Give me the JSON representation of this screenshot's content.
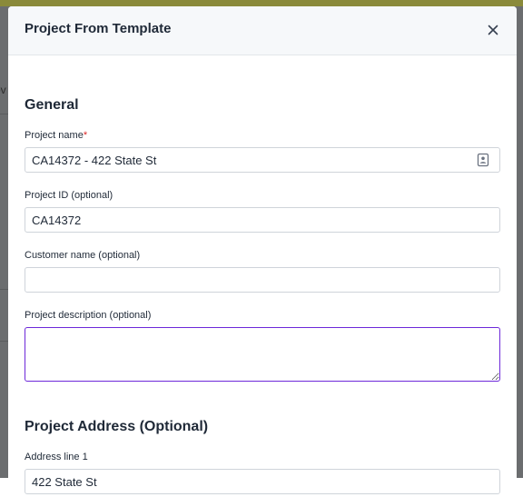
{
  "modal": {
    "title": "Project From Template",
    "close_icon": "close-icon"
  },
  "backdrop": {
    "partial_text": "ov"
  },
  "general": {
    "heading": "General",
    "project_name": {
      "label": "Project name",
      "required_marker": "*",
      "value": "CA14372 - 422 State St",
      "icon": "contact-card-icon"
    },
    "project_id": {
      "label": "Project ID (optional)",
      "value": "CA14372"
    },
    "customer_name": {
      "label": "Customer name (optional)",
      "value": ""
    },
    "project_description": {
      "label": "Project description (optional)",
      "value": ""
    }
  },
  "address": {
    "heading": "Project Address (Optional)",
    "address_line_1": {
      "label": "Address line 1",
      "value": "422 State St"
    }
  },
  "colors": {
    "focus_border": "#6d28d9",
    "required": "#dc2626",
    "header_bg": "#f6f8fa"
  }
}
